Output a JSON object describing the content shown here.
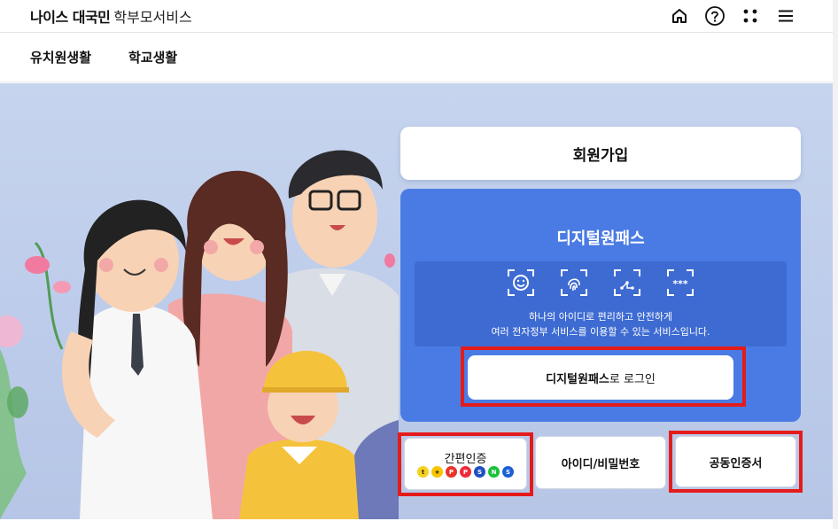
{
  "header": {
    "brand": "나이스 대국민",
    "service": "학부모서비스",
    "icons": [
      "home-icon",
      "help-icon",
      "apps-icon",
      "menu-icon"
    ]
  },
  "nav": {
    "items": [
      {
        "label": "유치원생활"
      },
      {
        "label": "학교생활"
      }
    ]
  },
  "main": {
    "join_label": "회원가입",
    "digital_pass": {
      "title": "디지털원패스",
      "auth_icons": [
        "face-recognition-icon",
        "fingerprint-icon",
        "pattern-icon",
        "pin-icon"
      ],
      "pin_text": "***",
      "desc_line1": "하나의 아이디로 편리하고 안전하게",
      "desc_line2": "여러 전자정부 서비스를 이용할 수 있는 서비스입니다.",
      "login_bold": "디지털원패스",
      "login_rest": "로 로그인"
    },
    "easy_auth": {
      "label": "간편인증",
      "providers": [
        {
          "name": "kakao",
          "mark": "t",
          "color": "#f5d21d",
          "text": "#3a1d1d"
        },
        {
          "name": "kb",
          "mark": "★",
          "color": "#f7c600",
          "text": "#4a3a00"
        },
        {
          "name": "pass",
          "mark": "P",
          "color": "#e8342c",
          "text": "#ffffff"
        },
        {
          "name": "payco",
          "mark": "P",
          "color": "#ee2a3a",
          "text": "#ffffff"
        },
        {
          "name": "samsung",
          "mark": "S",
          "color": "#1e4fc2",
          "text": "#ffffff"
        },
        {
          "name": "naver",
          "mark": "N",
          "color": "#19c23a",
          "text": "#ffffff"
        },
        {
          "name": "shinhan",
          "mark": "S",
          "color": "#1a5fd6",
          "text": "#ffffff"
        }
      ]
    },
    "id_password_label": "아이디/비밀번호",
    "certificate_label": "공동인증서"
  },
  "colors": {
    "panel_blue": "#4a7be4",
    "inner_blue": "#3d6bd2",
    "highlight_red": "#e41b1b",
    "hero_bg": "#c2d1ec"
  }
}
